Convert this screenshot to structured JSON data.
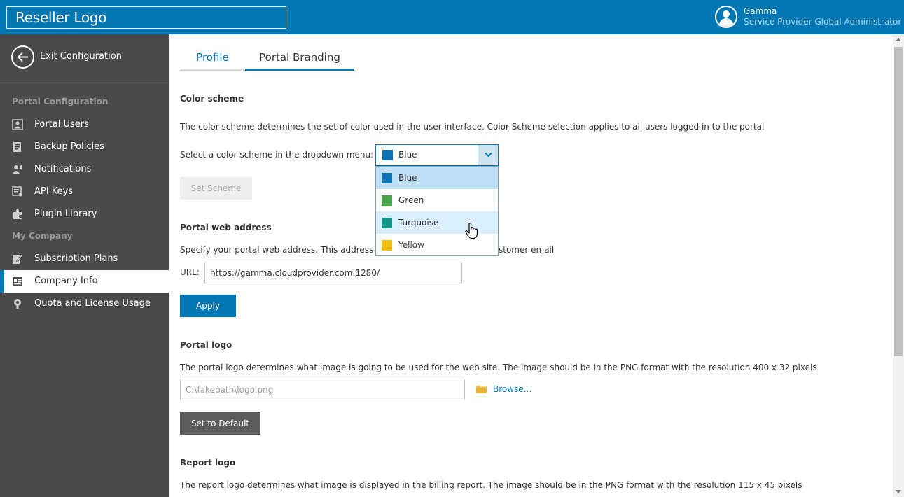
{
  "header": {
    "logo_text": "Reseller Logo",
    "user_name": "Gamma",
    "user_role": "Service Provider Global Administrator"
  },
  "sidebar": {
    "exit_label": "Exit Configuration",
    "sections": [
      {
        "title": "Portal Configuration",
        "items": [
          {
            "label": "Portal Users",
            "icon": "users-icon"
          },
          {
            "label": "Backup Policies",
            "icon": "policy-icon"
          },
          {
            "label": "Notifications",
            "icon": "bell-icon"
          },
          {
            "label": "API Keys",
            "icon": "key-icon"
          },
          {
            "label": "Plugin Library",
            "icon": "plugin-icon"
          }
        ]
      },
      {
        "title": "My Company",
        "items": [
          {
            "label": "Subscription Plans",
            "icon": "plans-icon"
          },
          {
            "label": "Company Info",
            "icon": "company-icon",
            "active": true
          },
          {
            "label": "Quota and License Usage",
            "icon": "quota-icon"
          }
        ]
      }
    ]
  },
  "tabs": [
    {
      "label": "Profile"
    },
    {
      "label": "Portal Branding",
      "active": true
    }
  ],
  "color_scheme": {
    "title": "Color scheme",
    "description": "The color scheme determines the set of color used in the user interface. Color Scheme selection applies to all users logged in to the portal",
    "select_label": "Select a color scheme in the dropdown menu:",
    "selected": "Blue",
    "options": [
      {
        "label": "Blue",
        "color": "#0f72b2"
      },
      {
        "label": "Green",
        "color": "#4aa64a"
      },
      {
        "label": "Turquoise",
        "color": "#14968a"
      },
      {
        "label": "Yellow",
        "color": "#f1be16"
      }
    ],
    "button_label": "Set Scheme"
  },
  "web_address": {
    "title": "Portal web address",
    "description_start": "Specify your portal web address. This address w",
    "description_end": "stomer email",
    "url_label": "URL:",
    "url_value": "https://gamma.cloudprovider.com:1280/",
    "button_label": "Apply"
  },
  "portal_logo": {
    "title": "Portal logo",
    "description": "The portal logo determines what image is going to be used for the web site. The image should be in the PNG format with the resolution 400 x 32 pixels",
    "file_value": "C:\\fakepath\\logo.png",
    "browse_label": "Browse...",
    "button_label": "Set to Default"
  },
  "report_logo": {
    "title": "Report logo",
    "description": "The report logo determines what image is displayed in the billing report. The image should be in the PNG format with the resolution 115 x 45 pixels"
  },
  "colors": {
    "accent": "#0077b3",
    "sidebar_bg": "#4a4a4a"
  }
}
